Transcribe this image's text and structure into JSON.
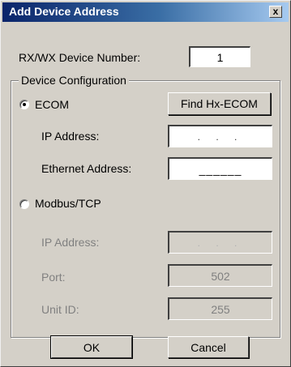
{
  "window": {
    "title": "Add Device Address",
    "close_glyph": "x"
  },
  "device_number": {
    "label": "RX/WX Device Number:",
    "value": "1"
  },
  "device_configuration": {
    "group_label": "Device Configuration",
    "ecom": {
      "radio_label": "ECOM",
      "selected": true,
      "find_button": "Find Hx-ECOM",
      "ip_label": "IP Address:",
      "ip_value": ". . .",
      "ethernet_label": "Ethernet Address:",
      "ethernet_value": "______"
    },
    "modbus_tcp": {
      "radio_label": "Modbus/TCP",
      "selected": false,
      "ip_label": "IP Address:",
      "ip_value": ". . .",
      "port_label": "Port:",
      "port_value": "502",
      "unit_id_label": "Unit ID:",
      "unit_id_value": "255"
    }
  },
  "buttons": {
    "ok": "OK",
    "cancel": "Cancel"
  }
}
